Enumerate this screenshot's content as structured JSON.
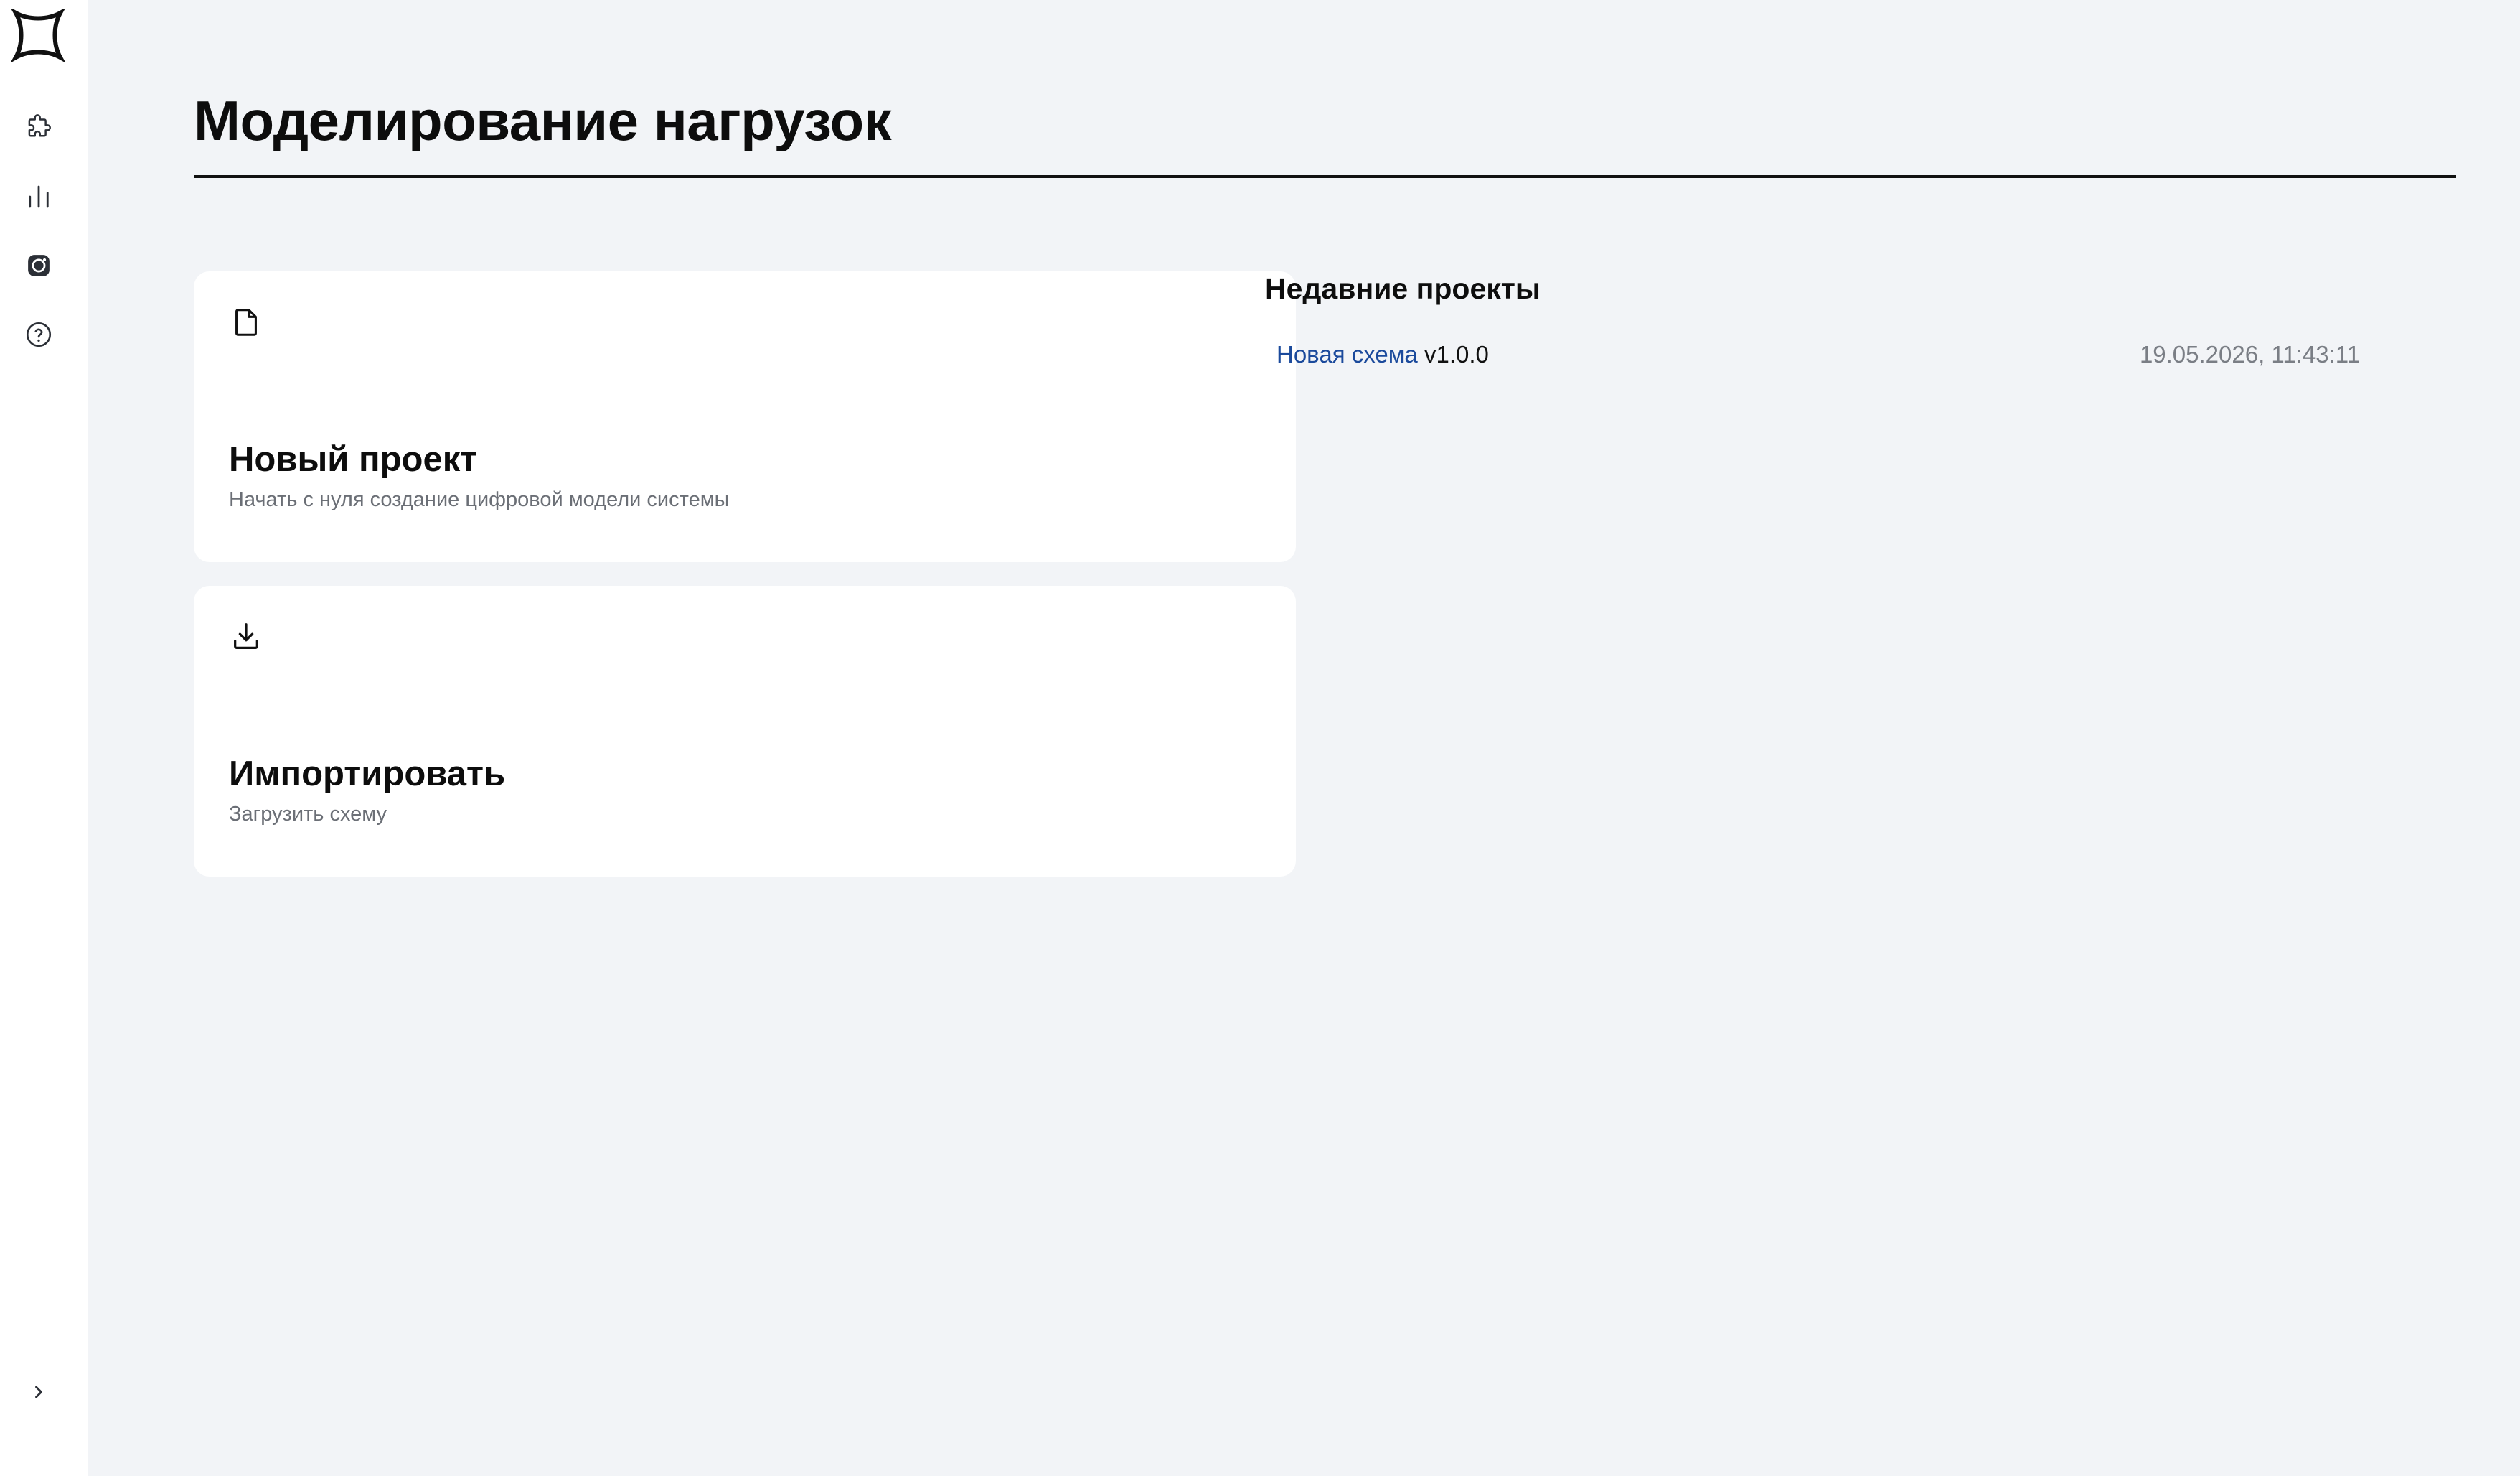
{
  "sidebar": {
    "logo_icon": "star-cross-logo",
    "items": [
      {
        "name": "plugins",
        "icon": "puzzle-icon"
      },
      {
        "name": "analytics",
        "icon": "bar-chart-icon"
      },
      {
        "name": "dashboard",
        "icon": "rounded-square-icon"
      },
      {
        "name": "help",
        "icon": "question-circle-icon"
      }
    ],
    "expand_icon": "chevron-right-icon"
  },
  "main": {
    "title": "Моделирование нагрузок",
    "cards": [
      {
        "icon": "file-icon",
        "title": "Новый проект",
        "subtitle": "Начать с нуля создание цифровой модели системы"
      },
      {
        "icon": "download-icon",
        "title": "Импортировать",
        "subtitle": "Загрузить схему"
      }
    ]
  },
  "recent": {
    "title": "Недавние проекты",
    "projects": [
      {
        "name": "Новая схема",
        "version": "v1.0.0",
        "date": "19.05.2026, 11:43:11"
      }
    ]
  },
  "colors": {
    "background": "#f2f4f7",
    "sidebar": "#ffffff",
    "card": "#ffffff",
    "link": "#1b4a9c",
    "muted": "#6b6f76"
  }
}
